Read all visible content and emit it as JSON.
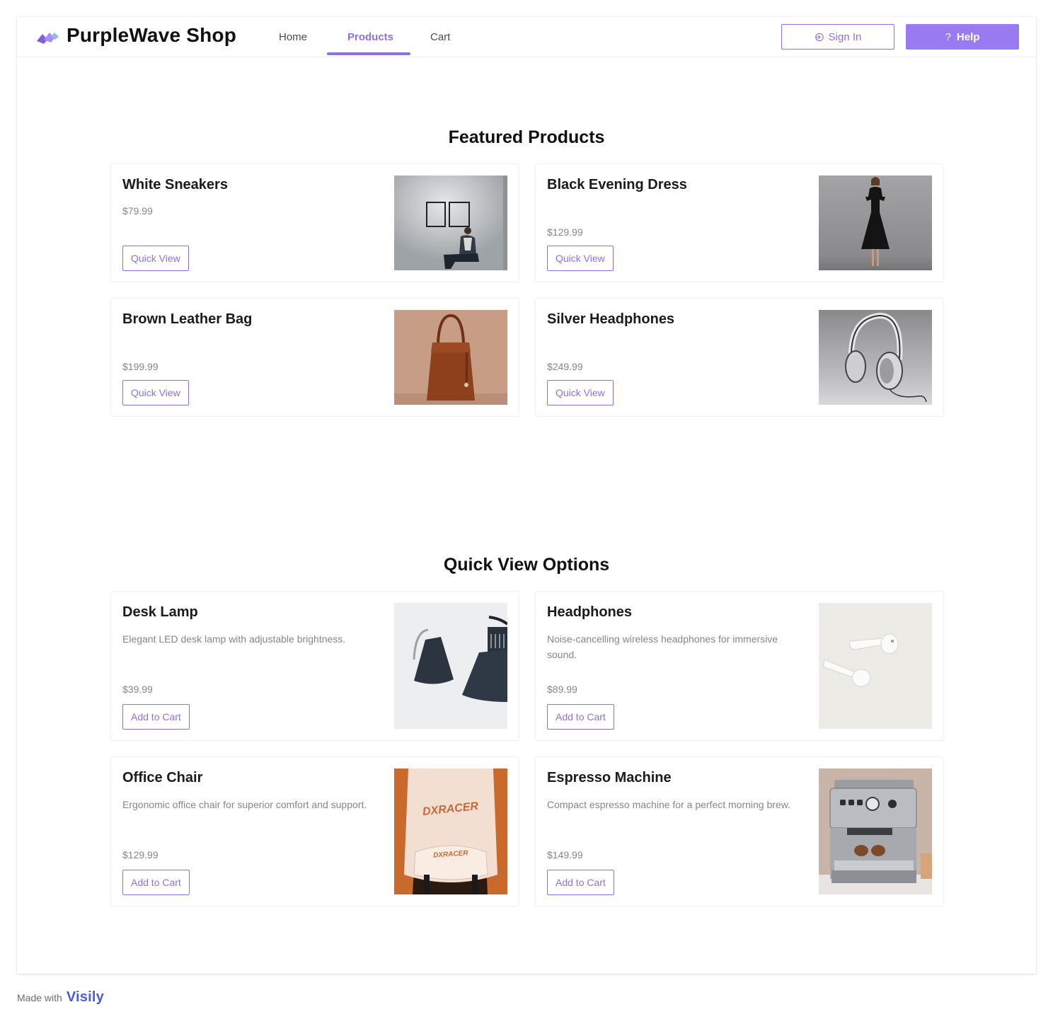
{
  "header": {
    "brand": "PurpleWave Shop",
    "nav": [
      {
        "label": "Home",
        "active": false
      },
      {
        "label": "Products",
        "active": true
      },
      {
        "label": "Cart",
        "active": false
      }
    ],
    "signin_label": "Sign In",
    "signin_icon": "sign-in-icon",
    "help_label": "Help",
    "help_icon": "question-icon"
  },
  "featured": {
    "title": "Featured Products",
    "products": [
      {
        "name": "White Sneakers",
        "price": "$79.99",
        "action": "Quick View",
        "image": "person-seated-in-gallery-photo"
      },
      {
        "name": "Black Evening Dress",
        "price": "$129.99",
        "action": "Quick View",
        "image": "woman-in-black-dress-photo"
      },
      {
        "name": "Brown Leather Bag",
        "price": "$199.99",
        "action": "Quick View",
        "image": "brown-leather-bag-photo"
      },
      {
        "name": "Silver Headphones",
        "price": "$249.99",
        "action": "Quick View",
        "image": "silver-headphones-photo"
      }
    ]
  },
  "quick_view": {
    "title": "Quick View Options",
    "products": [
      {
        "name": "Desk Lamp",
        "description": "Elegant LED desk lamp with adjustable brightness.",
        "price": "$39.99",
        "action": "Add to Cart",
        "image": "desk-lamp-photo"
      },
      {
        "name": "Headphones",
        "description": "Noise-cancelling wireless headphones for immersive sound.",
        "price": "$89.99",
        "action": "Add to Cart",
        "image": "wireless-earbuds-photo"
      },
      {
        "name": "Office Chair",
        "description": "Ergonomic office chair for superior comfort and support.",
        "price": "$129.99",
        "action": "Add to Cart",
        "image": "office-chair-photo",
        "image_text": [
          "DXRACER",
          "DXRACER"
        ]
      },
      {
        "name": "Espresso Machine",
        "description": "Compact espresso machine for a perfect morning brew.",
        "price": "$149.99",
        "action": "Add to Cart",
        "image": "espresso-machine-photo"
      }
    ]
  },
  "footer": {
    "made_with": "Made with",
    "brand": "Visily"
  },
  "colors": {
    "accent": "#8f6fe8",
    "help_button": "#9a7af0",
    "muted_text": "#85858d"
  }
}
